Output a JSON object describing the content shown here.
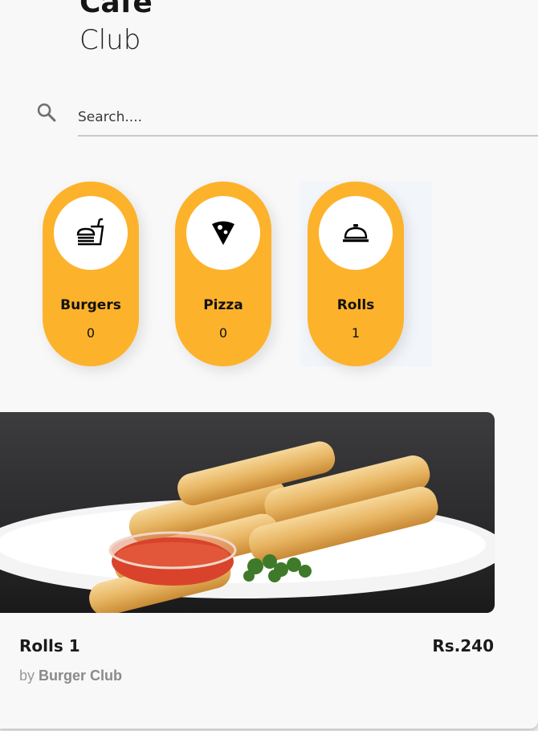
{
  "header": {
    "title": "Cafe",
    "subtitle": "Club"
  },
  "search": {
    "placeholder": "Search....",
    "icon": "search-icon"
  },
  "categories": [
    {
      "name": "Burgers",
      "count": "0",
      "icon": "fastfood-icon"
    },
    {
      "name": "Pizza",
      "count": "0",
      "icon": "pizza-slice-icon"
    },
    {
      "name": "Rolls",
      "count": "1",
      "icon": "room-service-icon",
      "selected": true
    }
  ],
  "product": {
    "name": "Rolls 1",
    "price": "Rs.240",
    "by_prefix": "by",
    "brand": "Burger Club",
    "image": "spring-rolls-on-plate-image"
  },
  "colors": {
    "accent": "#fdb22b",
    "background": "#f8f8f8",
    "text": "#1a1a1a"
  }
}
